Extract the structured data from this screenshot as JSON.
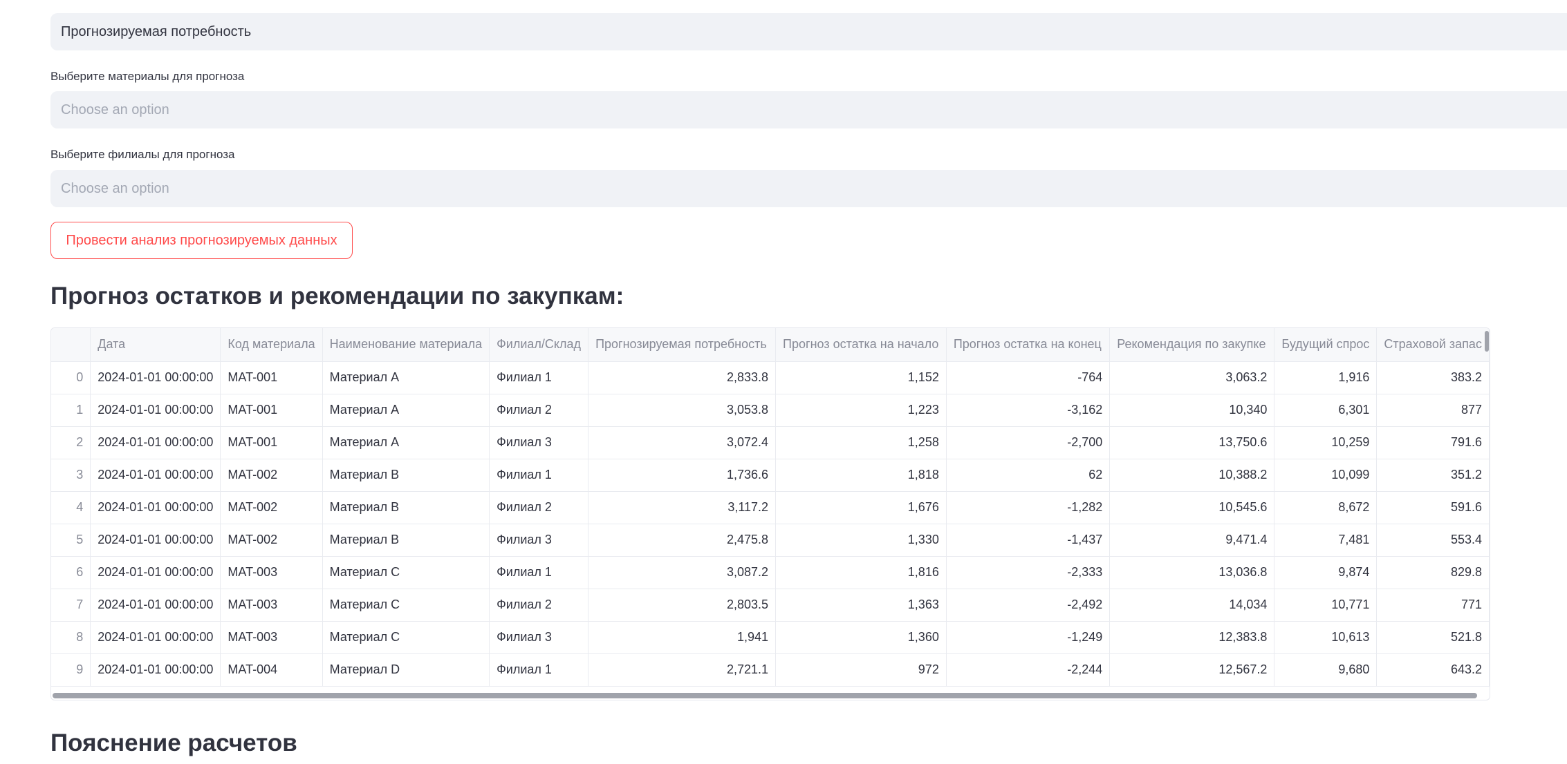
{
  "forecast_type": {
    "value": "Прогнозируемая потребность"
  },
  "materials_select": {
    "label": "Выберите материалы для прогноза",
    "placeholder": "Choose an option"
  },
  "branches_select": {
    "label": "Выберите филиалы для прогноза",
    "placeholder": "Choose an option"
  },
  "run_button": {
    "label": "Провести анализ прогнозируемых данных"
  },
  "table_section": {
    "title": "Прогноз остатков и рекомендации по закупкам:"
  },
  "explanation_section": {
    "title": "Пояснение расчетов"
  },
  "table": {
    "columns": [
      "",
      "Дата",
      "Код материала",
      "Наименование материала",
      "Филиал/Склад",
      "Прогнозируемая потребность",
      "Прогноз остатка на начало",
      "Прогноз остатка на конец",
      "Рекомендация по закупке",
      "Будущий спрос",
      "Страховой запас"
    ],
    "rows": [
      [
        "0",
        "2024-01-01 00:00:00",
        "MAT-001",
        "Материал A",
        "Филиал 1",
        "2,833.8",
        "1,152",
        "-764",
        "3,063.2",
        "1,916",
        "383.2"
      ],
      [
        "1",
        "2024-01-01 00:00:00",
        "MAT-001",
        "Материал A",
        "Филиал 2",
        "3,053.8",
        "1,223",
        "-3,162",
        "10,340",
        "6,301",
        "877"
      ],
      [
        "2",
        "2024-01-01 00:00:00",
        "MAT-001",
        "Материал A",
        "Филиал 3",
        "3,072.4",
        "1,258",
        "-2,700",
        "13,750.6",
        "10,259",
        "791.6"
      ],
      [
        "3",
        "2024-01-01 00:00:00",
        "MAT-002",
        "Материал B",
        "Филиал 1",
        "1,736.6",
        "1,818",
        "62",
        "10,388.2",
        "10,099",
        "351.2"
      ],
      [
        "4",
        "2024-01-01 00:00:00",
        "MAT-002",
        "Материал B",
        "Филиал 2",
        "3,117.2",
        "1,676",
        "-1,282",
        "10,545.6",
        "8,672",
        "591.6"
      ],
      [
        "5",
        "2024-01-01 00:00:00",
        "MAT-002",
        "Материал B",
        "Филиал 3",
        "2,475.8",
        "1,330",
        "-1,437",
        "9,471.4",
        "7,481",
        "553.4"
      ],
      [
        "6",
        "2024-01-01 00:00:00",
        "MAT-003",
        "Материал C",
        "Филиал 1",
        "3,087.2",
        "1,816",
        "-2,333",
        "13,036.8",
        "9,874",
        "829.8"
      ],
      [
        "7",
        "2024-01-01 00:00:00",
        "MAT-003",
        "Материал C",
        "Филиал 2",
        "2,803.5",
        "1,363",
        "-2,492",
        "14,034",
        "10,771",
        "771"
      ],
      [
        "8",
        "2024-01-01 00:00:00",
        "MAT-003",
        "Материал C",
        "Филиал 3",
        "1,941",
        "1,360",
        "-1,249",
        "12,383.8",
        "10,613",
        "521.8"
      ],
      [
        "9",
        "2024-01-01 00:00:00",
        "MAT-004",
        "Материал D",
        "Филиал 1",
        "2,721.1",
        "972",
        "-2,244",
        "12,567.2",
        "9,680",
        "643.2"
      ]
    ]
  }
}
